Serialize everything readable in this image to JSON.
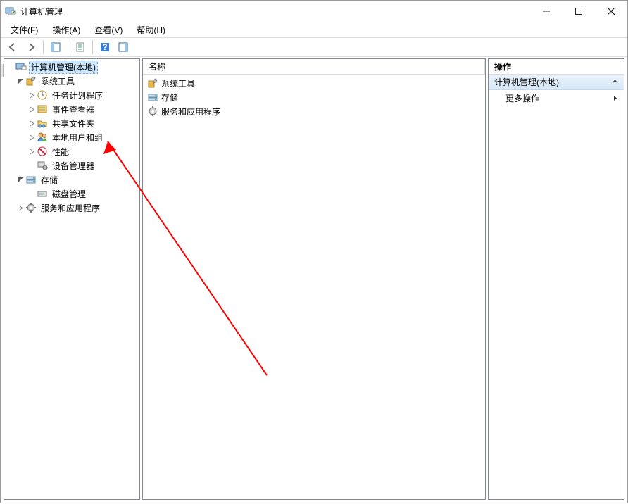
{
  "window": {
    "title": "计算机管理",
    "menus": {
      "file": "文件(F)",
      "action": "操作(A)",
      "view": "查看(V)",
      "help": "帮助(H)"
    }
  },
  "tree": {
    "root": "计算机管理(本地)",
    "system_tools": "系统工具",
    "task_scheduler": "任务计划程序",
    "event_viewer": "事件查看器",
    "shared_folders": "共享文件夹",
    "local_users_groups": "本地用户和组",
    "performance": "性能",
    "device_manager": "设备管理器",
    "storage": "存储",
    "disk_mgmt": "磁盘管理",
    "services_apps": "服务和应用程序"
  },
  "list": {
    "header_name": "名称",
    "row_system_tools": "系统工具",
    "row_storage": "存储",
    "row_services_apps": "服务和应用程序"
  },
  "actions": {
    "header": "操作",
    "section": "计算机管理(本地)",
    "more": "更多操作"
  }
}
